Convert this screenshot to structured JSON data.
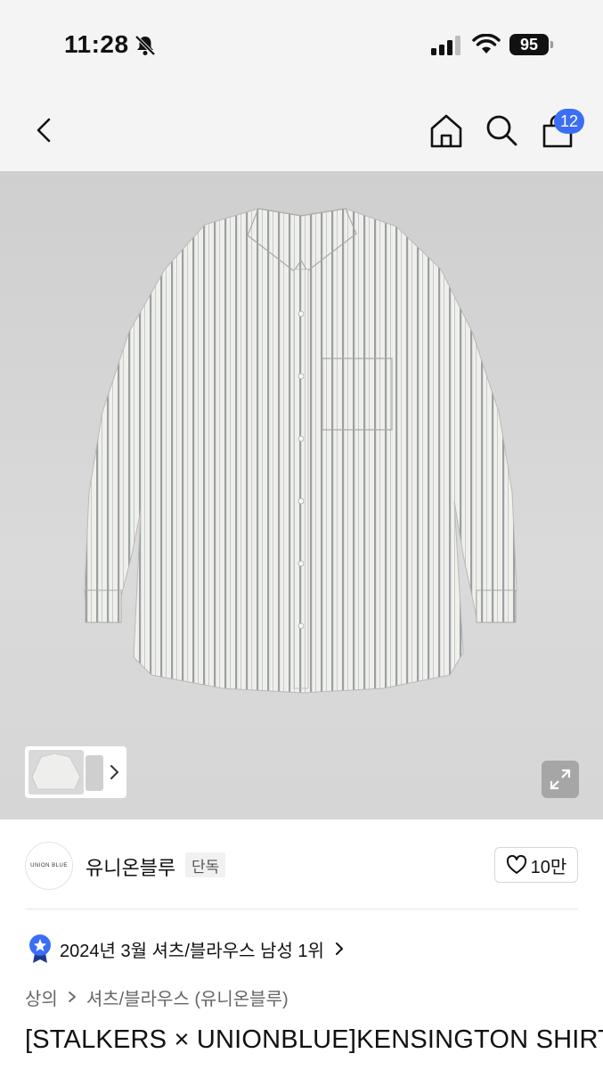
{
  "status_bar": {
    "time": "11:28",
    "battery": "95",
    "icons": [
      "bell-slash-icon",
      "signal-icon",
      "wifi-icon",
      "battery-icon"
    ]
  },
  "nav": {
    "icons": [
      "back-chevron-icon",
      "home-icon",
      "search-icon",
      "cart-icon"
    ],
    "cart_count": "12",
    "accent_color": "#3b6ef5"
  },
  "hero": {
    "image": "striped-shirt-photo",
    "thumbnail_icons": [
      "thumbnail-image",
      "chevron-right-icon"
    ],
    "expand_icon": "expand-icon"
  },
  "brand": {
    "logo_text": "UNION BLUE",
    "name": "유니온블루",
    "badge": "단독",
    "like_icon": "heart-icon",
    "like_count": "10만"
  },
  "ranking": {
    "icon": "ranking-medal-icon",
    "text": "2024년 3월 셔츠/블라우스 남성 1위"
  },
  "category": {
    "level1": "상의",
    "level2": "셔츠/블라우스 (유니온블루)"
  },
  "product": {
    "title": "[STALKERS × UNIONBLUE]KENSINGTON SHIRT"
  }
}
